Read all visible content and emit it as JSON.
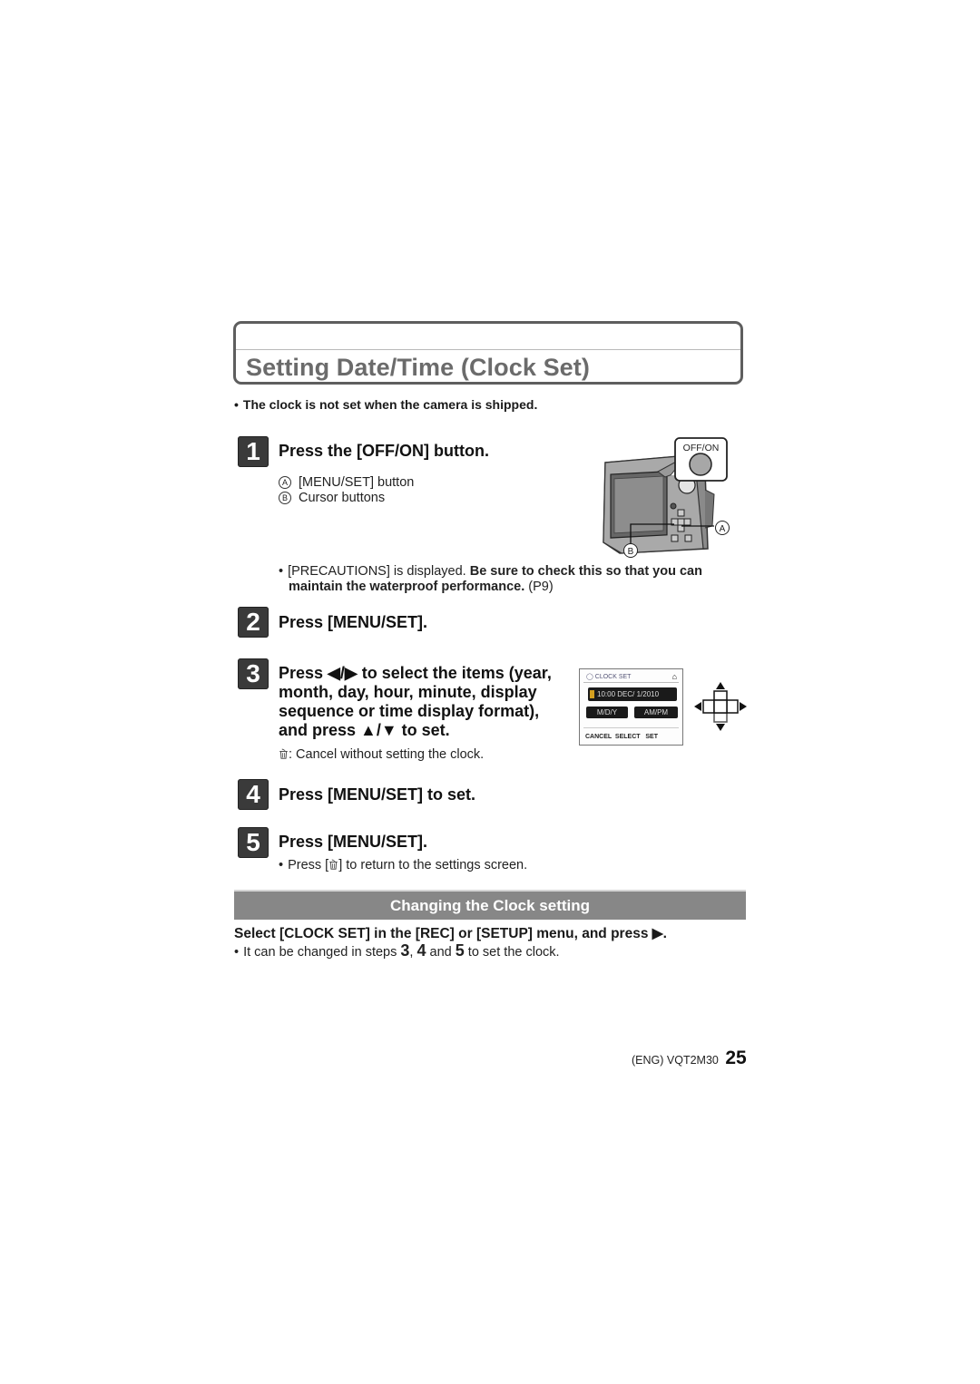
{
  "title": "Setting Date/Time (Clock Set)",
  "intro_note": "The clock is not set when the camera is shipped.",
  "steps": [
    {
      "number": "1",
      "heading": "Press the [OFF/ON] button.",
      "legend": [
        {
          "marker": "A",
          "text": "[MENU/SET] button"
        },
        {
          "marker": "B",
          "text": "Cursor buttons"
        }
      ],
      "illustration": {
        "button_label": "OFF/ON",
        "callout_a": "A",
        "callout_b": "B"
      },
      "note_plain": "[PRECAUTIONS] is displayed. ",
      "note_bold": "Be sure to check this so that you can maintain the waterproof performance.",
      "note_ref": " (P9)",
      "note_line1_bold": "Be sure to check this so that you can",
      "note_line2_bold": "maintain the waterproof performance.",
      "note_line2_ref": " (P9)"
    },
    {
      "number": "2",
      "heading": "Press [MENU/SET]."
    },
    {
      "number": "3",
      "heading_lines": [
        "Press ◀/▶ to select the items (year,",
        "month, day, hour, minute, display",
        "sequence or time display format),",
        "and press ▲/▼ to set."
      ],
      "cancel_note": ": Cancel without setting the clock.",
      "screen": {
        "header": "CLOCK SET",
        "datetime": "10:00  DEC/  1/2010",
        "format_left": "M/D/Y",
        "format_right": "AM/PM",
        "footer": "CANCEL  SELECT   SET"
      }
    },
    {
      "number": "4",
      "heading": "Press [MENU/SET] to set."
    },
    {
      "number": "5",
      "heading": "Press [MENU/SET].",
      "note_before": "Press [",
      "note_after": "] to return to the settings screen."
    }
  ],
  "section": {
    "title": "Changing the Clock setting",
    "instruction": "Select [CLOCK SET] in the [REC] or [SETUP] menu, and press ▶.",
    "note_parts": [
      "It can be changed in steps ",
      "3",
      ", ",
      "4",
      " and ",
      "5",
      " to set the clock."
    ]
  },
  "footer": {
    "code": "(ENG) VQT2M30",
    "page": "25"
  },
  "bullet": "•"
}
